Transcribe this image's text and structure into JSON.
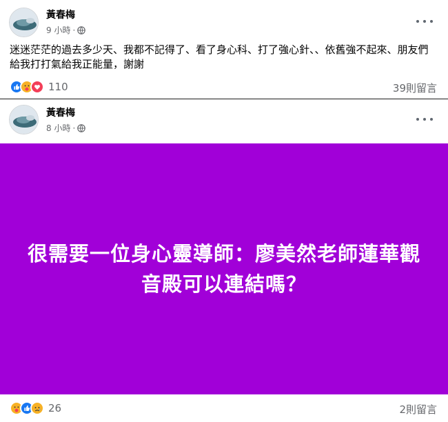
{
  "posts": [
    {
      "author": "黃春梅",
      "time": "9 小時",
      "separator": "·",
      "text": "迷迷茫茫的過去多少天、我都不記得了、看了身心科、打了強心針、、依舊強不起來、朋友們給我打打氣給我正能量，謝謝",
      "reactions": [
        "like",
        "care",
        "love"
      ],
      "reaction_count": "110",
      "comments": "39則留言"
    },
    {
      "author": "黃春梅",
      "time": "8 小時",
      "separator": "·",
      "banner_text": "很需要一位身心靈導師：廖美然老師蓮華觀音殿可以連結嗎？",
      "banner_color": "#a100d8",
      "reactions": [
        "care",
        "like",
        "sad"
      ],
      "reaction_count": "26",
      "comments": "2則留言"
    }
  ]
}
